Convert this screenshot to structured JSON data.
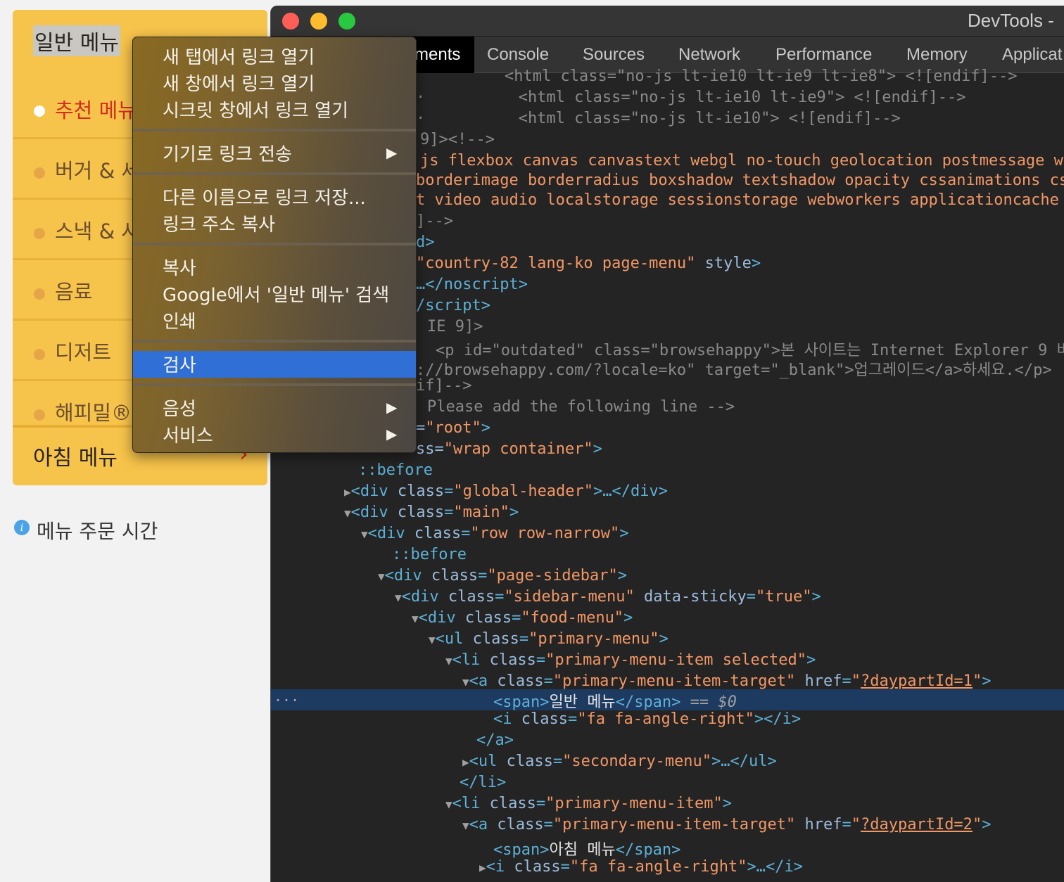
{
  "sidebar": {
    "title": "일반 메뉴",
    "items": [
      {
        "label": "추천 메뉴"
      },
      {
        "label": "버거 & 세"
      },
      {
        "label": "스낵 & 사"
      },
      {
        "label": "음료"
      },
      {
        "label": "디저트"
      },
      {
        "label": "해피밀®"
      }
    ],
    "next_section": "아침 메뉴",
    "chevron": "›",
    "order_time": "메뉴 주문 시간",
    "info_icon": "i"
  },
  "devtools": {
    "window_title": "DevTools - ",
    "tabs": [
      "ments",
      "Console",
      "Sources",
      "Network",
      "Performance",
      "Memory",
      "Applicat"
    ],
    "active_tab": "Elements",
    "selected_eq": "== $0",
    "ellipsis": "..."
  },
  "context_menu": {
    "items": [
      "새 탭에서 링크 열기",
      "새 창에서 링크 열기",
      "시크릿 창에서 링크 열기",
      "기기로 링크 전송",
      "다른 이름으로 링크 저장...",
      "링크 주소 복사",
      "복사",
      "Google에서 '일반 메뉴' 검색",
      "인쇄",
      "검사",
      "음성",
      "서비스"
    ],
    "highlighted": "검사",
    "submenu_arrow": "▶"
  },
  "colors": {
    "sidebar_bg": "#f6c34b",
    "active_red": "#d62c1e",
    "devtools_bg": "#242424",
    "selection": "#2f6fd6"
  }
}
